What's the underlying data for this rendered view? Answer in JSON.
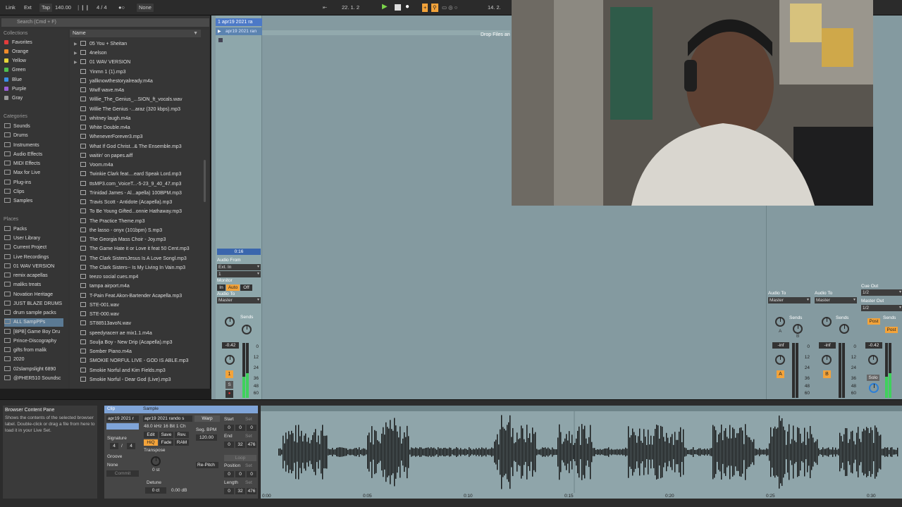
{
  "transport": {
    "link": "Link",
    "ext": "Ext",
    "tap": "Tap",
    "tempo": "140.00",
    "signature": "4 / 4",
    "quantize": "None",
    "position": "22.   1.   2",
    "loop_len": "14.   2."
  },
  "browser": {
    "search_placeholder": "Search (Cmd + F)",
    "collections_heading": "Collections",
    "collections": [
      {
        "label": "Favorites",
        "color": "#e23c3c"
      },
      {
        "label": "Orange",
        "color": "#f08a2a"
      },
      {
        "label": "Yellow",
        "color": "#e6d43a"
      },
      {
        "label": "Green",
        "color": "#4fc04f"
      },
      {
        "label": "Blue",
        "color": "#3a8ee6"
      },
      {
        "label": "Purple",
        "color": "#9a5fd6"
      },
      {
        "label": "Gray",
        "color": "#999999"
      }
    ],
    "categories_heading": "Categories",
    "categories": [
      "Sounds",
      "Drums",
      "Instruments",
      "Audio Effects",
      "MIDI Effects",
      "Max for Live",
      "Plug-ins",
      "Clips",
      "Samples"
    ],
    "places_heading": "Places",
    "places": [
      "Packs",
      "User Library",
      "Current Project",
      "Live Recordings",
      "01 WAV VERSION",
      "remix acapellas",
      "maliks treats",
      "Novation Heritage",
      "JUST BLAZE DRUMS",
      "drum sample packs",
      "ALL SampPPs",
      "[BPB] Game Boy Dru",
      "Prince-Discography",
      "gifts from malik",
      "2020",
      "02slampslight 6890",
      "@PHER510 Soundsc"
    ],
    "list_header": "Name",
    "files": [
      {
        "name": "05 You + Sheitan",
        "folder": true
      },
      {
        "name": "4nelson",
        "folder": true
      },
      {
        "name": "01 WAV VERSION",
        "folder": true
      },
      {
        "name": "Yinmn 1 (1).mp3"
      },
      {
        "name": "yallknowthestoryalready.m4a"
      },
      {
        "name": "Wwlf wave.m4a"
      },
      {
        "name": "Willie_The_Genius_...SION_ft_vocals.wav"
      },
      {
        "name": "Willie The Genius -...araz (320 kbps).mp3"
      },
      {
        "name": "whitney laugh.m4a"
      },
      {
        "name": "White Double.m4a"
      },
      {
        "name": "WheneverForever3.mp3"
      },
      {
        "name": "What If God Christ...& The Ensemble.mp3"
      },
      {
        "name": "waitin' on papes.aiff"
      },
      {
        "name": "Voom.m4a"
      },
      {
        "name": "Twinkie Clark feat....eard Speak Lord.mp3"
      },
      {
        "name": "ttsMP3.com_VoiceT...-5-23_9_40_47.mp3"
      },
      {
        "name": "Trinidad James - Al...apella) 100BPM.mp3"
      },
      {
        "name": "Travis Scott - Antidote (Acapella).mp3"
      },
      {
        "name": "To Be Young Gifted...onnie Hathaway.mp3"
      },
      {
        "name": "The Practice Theme.mp3"
      },
      {
        "name": "the lasso - onyx (101bpm) S.mp3"
      },
      {
        "name": "The Georgia Mass Choir - Joy.mp3"
      },
      {
        "name": "The Game Hate it or Love it feat 50 Cent.mp3"
      },
      {
        "name": "The Clark SistersJesus Is A Love Songl.mp3"
      },
      {
        "name": "The Clark Sisters-- Is My Living In Vain.mp3"
      },
      {
        "name": "teezo social cues.mp4"
      },
      {
        "name": "tampa airport.m4a"
      },
      {
        "name": "T-Pain Feat.Akon-Bartender Acapella.mp3"
      },
      {
        "name": "STE-001.wav"
      },
      {
        "name": "STE-000.wav"
      },
      {
        "name": "ST88513avoN.wav"
      },
      {
        "name": "speedyracerr ae mix1.1.m4a"
      },
      {
        "name": "Soulja Boy - New Drip (Acapella).mp3"
      },
      {
        "name": "Somber Piano.m4a"
      },
      {
        "name": "SMOKIE NORFUL LIVE - GOD IS ABLE.mp3"
      },
      {
        "name": "Smokie Norful and Kim Fields.mp3"
      },
      {
        "name": "Smokie Norful - Dear God (Live).mp3"
      }
    ]
  },
  "session": {
    "track_title": "1 apr19 2021 ra",
    "clip_name": "apr19 2021 ran",
    "drop_text": "Drop Files an",
    "clip_time": "0:16",
    "audio_from_label": "Audio From",
    "audio_from_value": "Ext. In",
    "audio_from_channel": "1",
    "monitor_label": "Monitor",
    "monitor_in": "In",
    "monitor_auto": "Auto",
    "monitor_off": "Off",
    "audio_to_label": "Audio To",
    "audio_to_value": "Master",
    "sends_label": "Sends",
    "volume": "-0.42",
    "track_number": "1",
    "solo": "S",
    "scale": [
      "0",
      "12",
      "24",
      "36",
      "48",
      "60"
    ]
  },
  "mixer_right": {
    "audio_to_a": "Audio To",
    "master_a": "Master",
    "audio_to_b": "Audio To",
    "master_b": "Master",
    "cue_out_label": "Cue Out",
    "cue_out_value": "1/2",
    "master_out_label": "Master Out",
    "master_out_value": "1/2",
    "sends_a": "Sends",
    "sends_b": "Sends",
    "sends_c": "Sends",
    "vol_a": "-inf",
    "vol_b": "-inf",
    "vol_c": "-0.42",
    "return_a": "A",
    "return_b": "B",
    "knob_a": "A",
    "knob_b": "B",
    "post": "Post",
    "solo": "Solo",
    "scale": [
      "0",
      "12",
      "24",
      "36",
      "48",
      "60"
    ]
  },
  "detail": {
    "info_title": "Browser Content Pane",
    "info_text": "Shows the contents of the selected browser label. Double-click or drag a file from here to load it in your Live Set.",
    "clip_tab": "Clip",
    "sample_tab": "Sample",
    "clip_name": "apr19 2021 r",
    "sample_name": "apr19 2021 rando s",
    "sample_info": "48.0 kHz 16 Bit 1 Ch",
    "signature_label": "Signature",
    "sig_num": "4",
    "sig_den": "4",
    "groove_label": "Groove",
    "groove_value": "None",
    "commit": "Commit",
    "edit": "Edit",
    "save": "Save",
    "rev": "Rev.",
    "hiq": "HiQ",
    "fade": "Fade",
    "ram": "RAM",
    "warp": "Warp",
    "seg_bpm_label": "Seg. BPM",
    "seg_bpm": "120.00",
    "transpose_label": "Transpose",
    "transpose_value": "0 st",
    "detune_label": "Detune",
    "detune_value": "0 ct",
    "gain_value": "0.00 dB",
    "repitch": "Re-Pitch",
    "start_label": "Start",
    "end_label": "End",
    "loop_label": "Loop",
    "position_label": "Position",
    "length_label": "Length",
    "set": "Set",
    "start_vals": [
      "0",
      "0",
      "0"
    ],
    "end_vals": [
      "0",
      "32",
      "476"
    ],
    "position_vals": [
      "0",
      "0",
      "0"
    ],
    "length_vals": [
      "0",
      "32",
      "476"
    ],
    "time_ticks": [
      "0:00",
      "0:05",
      "0:10",
      "0:15",
      "0:20",
      "0:25",
      "0:30"
    ]
  }
}
